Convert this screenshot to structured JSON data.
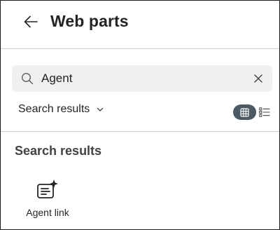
{
  "header": {
    "title": "Web parts",
    "back_icon": "arrow-left-icon"
  },
  "search": {
    "value": "Agent",
    "search_icon": "search-icon",
    "clear_icon": "dismiss-icon"
  },
  "filter": {
    "selected": "Search results",
    "chevron_icon": "chevron-down-icon"
  },
  "view_toggle": {
    "grid_icon": "grid-view-icon",
    "list_icon": "list-view-icon",
    "active": "grid",
    "active_color": "#4d5a64"
  },
  "results": {
    "section_title": "Search results",
    "items": [
      {
        "label": "Agent link",
        "icon": "agent-link-icon"
      }
    ]
  },
  "colors": {
    "text": "#242424",
    "subtle_text": "#424242",
    "search_bg": "#f0f0f0",
    "divider": "#d1d1d1",
    "frame_border": "#1a1a1a"
  }
}
